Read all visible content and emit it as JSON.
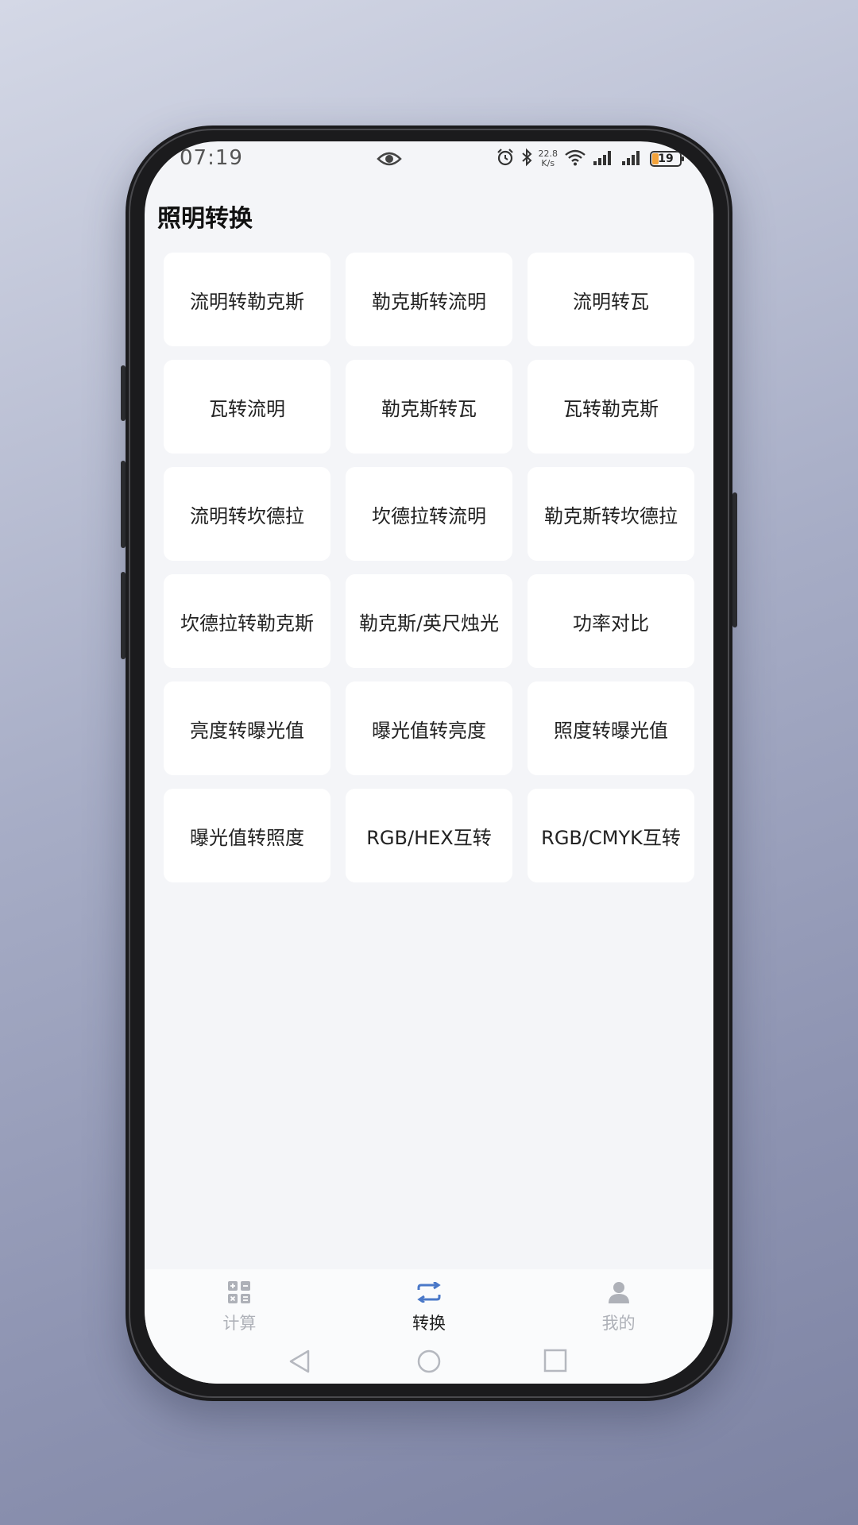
{
  "status_bar": {
    "time": "07:19",
    "net_speed_value": "22.8",
    "net_speed_unit": "K/s",
    "battery_level": "19"
  },
  "header": {
    "title": "照明转换"
  },
  "tiles": [
    {
      "label": "流明转勒克斯"
    },
    {
      "label": "勒克斯转流明"
    },
    {
      "label": "流明转瓦"
    },
    {
      "label": "瓦转流明"
    },
    {
      "label": "勒克斯转瓦"
    },
    {
      "label": "瓦转勒克斯"
    },
    {
      "label": "流明转坎德拉"
    },
    {
      "label": "坎德拉转流明"
    },
    {
      "label": "勒克斯转坎德拉"
    },
    {
      "label": "坎德拉转勒克斯"
    },
    {
      "label": "勒克斯/英尺烛光"
    },
    {
      "label": "功率对比"
    },
    {
      "label": "亮度转曝光值"
    },
    {
      "label": "曝光值转亮度"
    },
    {
      "label": "照度转曝光值"
    },
    {
      "label": "曝光值转照度"
    },
    {
      "label": "RGB/HEX互转"
    },
    {
      "label": "RGB/CMYK互转"
    }
  ],
  "bottom_nav": {
    "items": [
      {
        "label": "计算",
        "icon": "grid-calc-icon",
        "active": false
      },
      {
        "label": "转换",
        "icon": "swap-arrows-icon",
        "active": true
      },
      {
        "label": "我的",
        "icon": "person-icon",
        "active": false
      }
    ]
  },
  "colors": {
    "accent": "#4a78c8",
    "inactive": "#aeb1b8",
    "screen_bg": "#f4f5f8",
    "tile_bg": "#ffffff",
    "battery_fill": "#f2a23a"
  }
}
